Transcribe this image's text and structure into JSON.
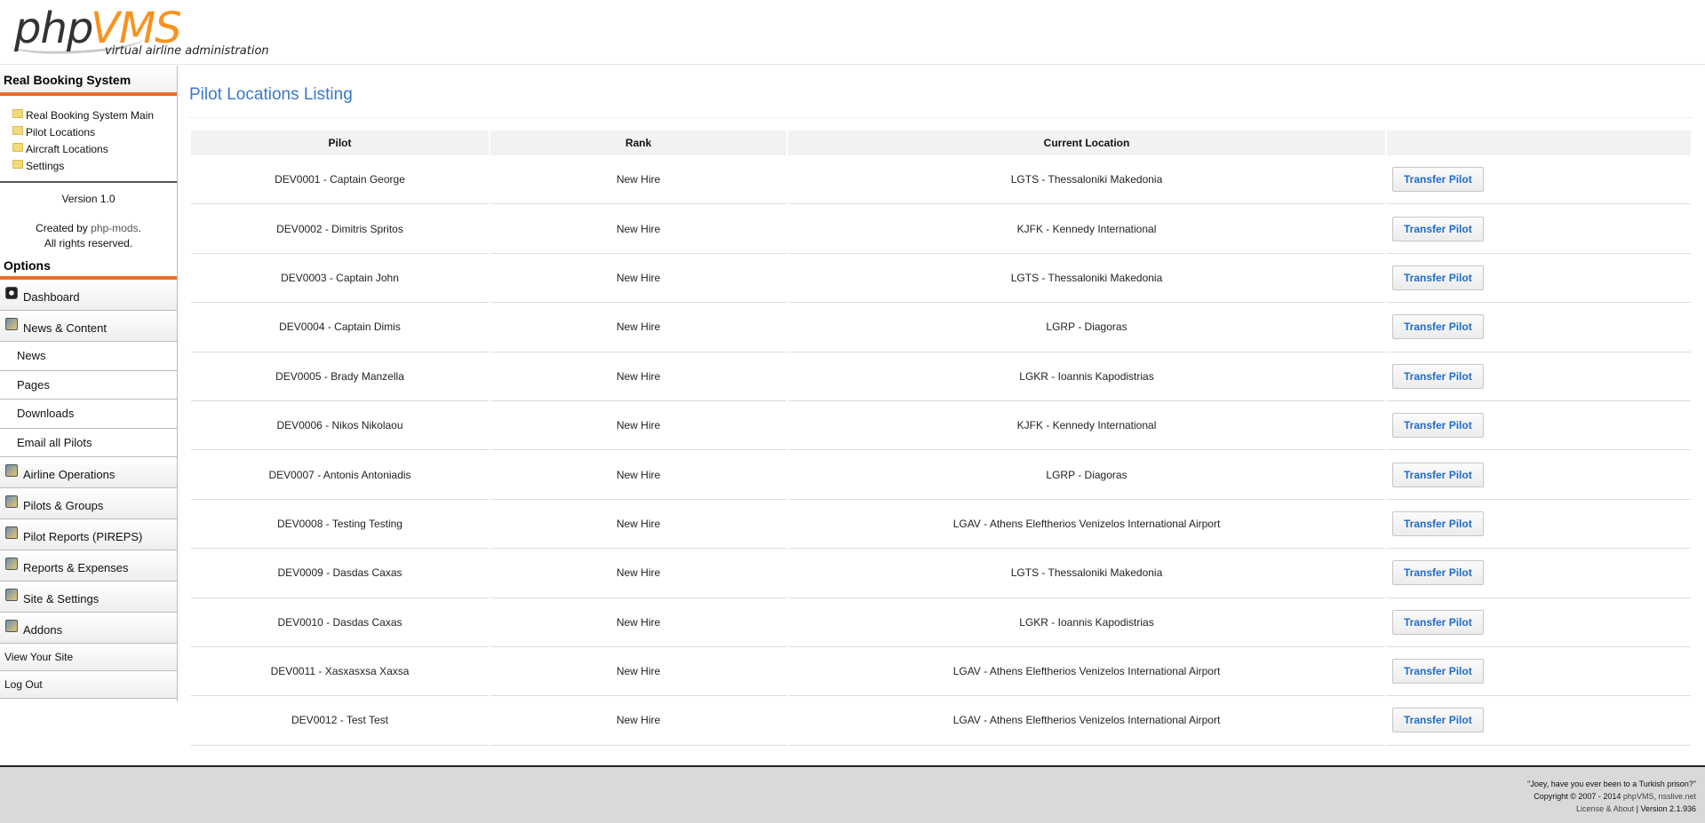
{
  "header": {
    "logo_php": "php",
    "logo_vms": "VMS",
    "tagline": "virtual airline administration"
  },
  "sidebar": {
    "module_heading": "Real Booking System",
    "module_links": [
      "Real Booking System Main",
      "Pilot Locations",
      "Aircraft Locations",
      "Settings"
    ],
    "version": "Version 1.0",
    "created_prefix": "Created by ",
    "created_by": "php-mods",
    "created_suffix": ".",
    "rights": "All rights reserved.",
    "options_heading": "Options",
    "menu": {
      "dashboard": "Dashboard",
      "news_content": "News & Content",
      "news": "News",
      "pages": "Pages",
      "downloads": "Downloads",
      "email_pilots": "Email all Pilots",
      "airline_operations": "Airline Operations",
      "pilots_groups": "Pilots & Groups",
      "pireps": "Pilot Reports (PIREPS)",
      "reports_expenses": "Reports & Expenses",
      "site_settings": "Site & Settings",
      "addons": "Addons",
      "view_site": "View Your Site",
      "log_out": "Log Out"
    }
  },
  "main": {
    "title": "Pilot Locations Listing",
    "columns": [
      "Pilot",
      "Rank",
      "Current Location",
      ""
    ],
    "action_label": "Transfer Pilot",
    "rows": [
      {
        "pilot": "DEV0001 - Captain George",
        "rank": "New Hire",
        "location": "LGTS - Thessaloniki Makedonia"
      },
      {
        "pilot": "DEV0002 - Dimitris Spritos",
        "rank": "New Hire",
        "location": "KJFK - Kennedy International"
      },
      {
        "pilot": "DEV0003 - Captain John",
        "rank": "New Hire",
        "location": "LGTS - Thessaloniki Makedonia"
      },
      {
        "pilot": "DEV0004 - Captain Dimis",
        "rank": "New Hire",
        "location": "LGRP - Diagoras"
      },
      {
        "pilot": "DEV0005 - Brady Manzella",
        "rank": "New Hire",
        "location": "LGKR - Ioannis Kapodistrias"
      },
      {
        "pilot": "DEV0006 - Nikos Nikolaou",
        "rank": "New Hire",
        "location": "KJFK - Kennedy International"
      },
      {
        "pilot": "DEV0007 - Antonis Antoniadis",
        "rank": "New Hire",
        "location": "LGRP - Diagoras"
      },
      {
        "pilot": "DEV0008 - Testing Testing",
        "rank": "New Hire",
        "location": "LGAV - Athens Eleftherios Venizelos International Airport"
      },
      {
        "pilot": "DEV0009 - Dasdas Caxas",
        "rank": "New Hire",
        "location": "LGTS - Thessaloniki Makedonia"
      },
      {
        "pilot": "DEV0010 - Dasdas Caxas",
        "rank": "New Hire",
        "location": "LGKR - Ioannis Kapodistrias"
      },
      {
        "pilot": "DEV0011 - Xasxasxsa Xaxsa",
        "rank": "New Hire",
        "location": "LGAV - Athens Eleftherios Venizelos International Airport"
      },
      {
        "pilot": "DEV0012 - Test Test",
        "rank": "New Hire",
        "location": "LGAV - Athens Eleftherios Venizelos International Airport"
      }
    ]
  },
  "footer": {
    "quote": "\"Joey, have you ever been to a Turkish prison?\"",
    "copyright_prefix": "Copyright © 2007 - 2014 ",
    "phpvms_link": "phpVMS",
    "separator": ", ",
    "nsslive_link": "nsslive.net",
    "license_link": "License & About",
    "version": " | Version 2.1.936"
  },
  "colors": {
    "accent_orange": "#ef6b2a",
    "title_blue": "#3a78c9",
    "button_text": "#1f6dc8"
  }
}
